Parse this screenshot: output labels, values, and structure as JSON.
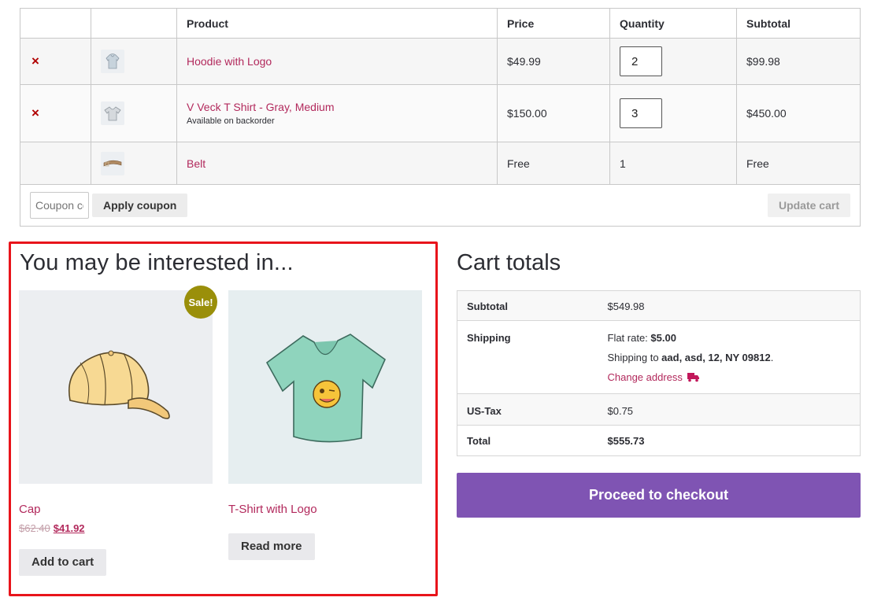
{
  "cart": {
    "headers": {
      "product": "Product",
      "price": "Price",
      "quantity": "Quantity",
      "subtotal": "Subtotal"
    },
    "items": [
      {
        "name": "Hoodie with Logo",
        "note": "",
        "price": "$49.99",
        "qty": "2",
        "subtotal": "$99.98",
        "removable": true
      },
      {
        "name": "V Veck T Shirt - Gray, Medium",
        "note": "Available on backorder",
        "price": "$150.00",
        "qty": "3",
        "subtotal": "$450.00",
        "removable": true
      },
      {
        "name": "Belt",
        "note": "",
        "price": "Free",
        "qty": "1",
        "subtotal": "Free",
        "removable": false
      }
    ],
    "remove_symbol": "×",
    "coupon_placeholder": "Coupon code",
    "apply_coupon_label": "Apply coupon",
    "update_cart_label": "Update cart"
  },
  "cross_sells": {
    "title": "You may be interested in...",
    "products": [
      {
        "name": "Cap",
        "badge": "Sale!",
        "old_price": "$62.40",
        "new_price": "$41.92",
        "button": "Add to cart",
        "icon": "cap-image"
      },
      {
        "name": "T-Shirt with Logo",
        "button": "Read more",
        "icon": "tshirt-image"
      }
    ]
  },
  "totals": {
    "title": "Cart totals",
    "subtotal_label": "Subtotal",
    "subtotal_value": "$549.98",
    "shipping_label": "Shipping",
    "shipping_method_prefix": "Flat rate: ",
    "shipping_method_value": "$5.00",
    "shipping_to_prefix": "Shipping to ",
    "shipping_to_address": "aad, asd, 12, NY 09812",
    "shipping_to_suffix": ".",
    "change_address_label": "Change address",
    "tax_label": "US-Tax",
    "tax_value": "$0.75",
    "total_label": "Total",
    "total_value": "$555.73",
    "checkout_label": "Proceed to checkout"
  },
  "colors": {
    "link": "#b2295c",
    "checkout": "#7f54b3",
    "sale_badge": "#9a8f0a",
    "remove": "#b00000",
    "highlight": "#e8141b"
  }
}
